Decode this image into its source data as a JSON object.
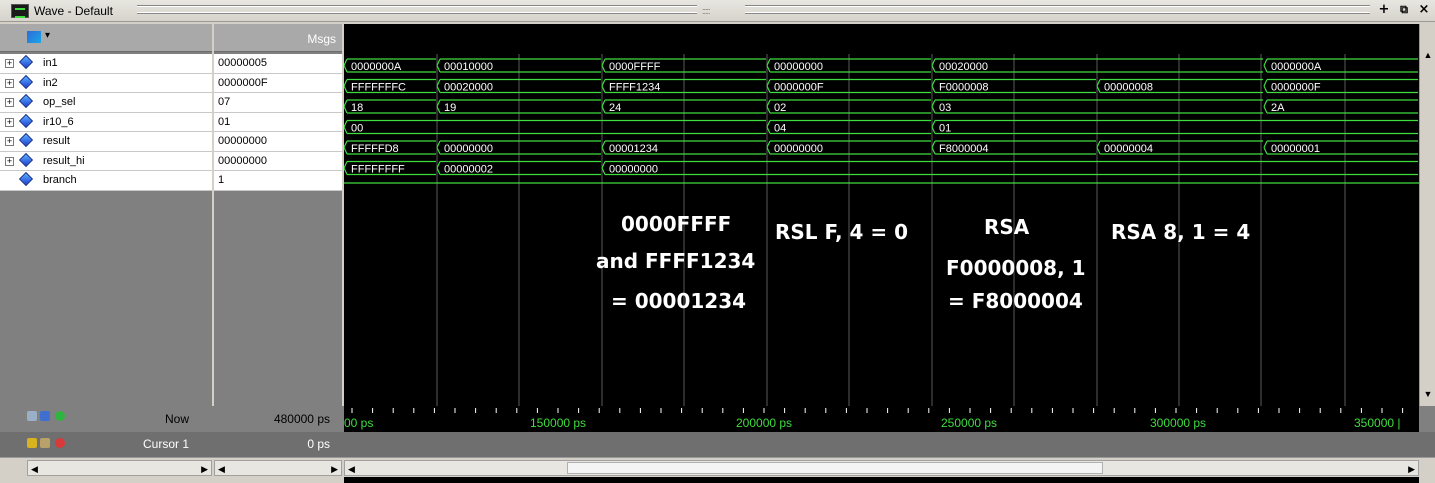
{
  "window": {
    "title": "Wave - Default"
  },
  "header": {
    "msgs_label": "Msgs"
  },
  "signals": [
    {
      "name": "in1",
      "msg": "00000005",
      "bus": true
    },
    {
      "name": "in2",
      "msg": "0000000F",
      "bus": true
    },
    {
      "name": "op_sel",
      "msg": "07",
      "bus": true
    },
    {
      "name": "ir10_6",
      "msg": "01",
      "bus": true
    },
    {
      "name": "result",
      "msg": "00000000",
      "bus": true
    },
    {
      "name": "result_hi",
      "msg": "00000000",
      "bus": true
    },
    {
      "name": "branch",
      "msg": "1",
      "bus": false
    }
  ],
  "waves": {
    "in1": [
      "0000000A",
      "00010000",
      "0000FFFF",
      "00000000",
      "00020000",
      "0000000A"
    ],
    "in2": [
      "FFFFFFFC",
      "00020000",
      "FFFF1234",
      "0000000F",
      "F0000008",
      "00000008",
      "0000000F"
    ],
    "op_sel": [
      "18",
      "19",
      "24",
      "02",
      "03",
      "2A"
    ],
    "ir10_6": [
      "00",
      "04",
      "01"
    ],
    "result": [
      "FFFFFD8",
      "00000000",
      "00001234",
      "00000000",
      "F8000004",
      "00000004",
      "00000001"
    ],
    "result_hi": [
      "FFFFFFFF",
      "00000002",
      "00000000"
    ]
  },
  "annotations": {
    "and_line1": "0000FFFF",
    "and_line2": "and FFFF1234",
    "and_line3": "= 00001234",
    "rsl": "RSL F, 4 = 0",
    "rsa1_line1": "RSA",
    "rsa1_line2": "F0000008, 1",
    "rsa1_line3": "= F8000004",
    "rsa2": "RSA 8, 1 = 4"
  },
  "status": {
    "now_label": "Now",
    "now_value": "480000 ps",
    "cursor_label": "Cursor 1",
    "cursor_value": "0 ps"
  },
  "timeline": {
    "labels": [
      "00 ps",
      "150000 ps",
      "200000 ps",
      "250000 ps",
      "300000 ps",
      "350000 |"
    ]
  },
  "colors": {
    "wave": "#3fdc3f",
    "background": "#000000",
    "text": "#ffffff"
  }
}
